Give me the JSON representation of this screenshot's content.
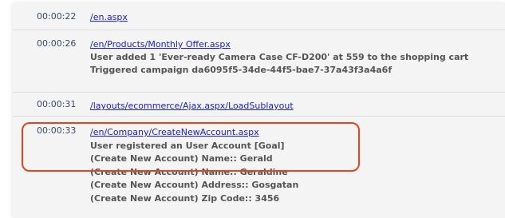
{
  "entries": [
    {
      "time": "00:00:22",
      "url": "/en.aspx",
      "details": []
    },
    {
      "time": "00:00:26",
      "url": "/en/Products/Monthly Offer.aspx",
      "details": [
        "User added 1 'Ever-ready Camera Case CF-D200' at 559 to the shopping cart",
        "Triggered campaign da6095f5-34de-44f5-bae7-37a43f3a4a6f"
      ]
    },
    {
      "time": "00:00:31",
      "url": "/layouts/ecommerce/Ajax.aspx/LoadSublayout",
      "details": []
    },
    {
      "time": "00:00:33",
      "url": "/en/Company/CreateNewAccount.aspx",
      "details": [
        "User registered an User Account [Goal]",
        "(Create New Account) Name:: Gerald",
        "(Create New Account) Name:: Geraldine",
        "(Create New Account) Address:: Gosgatan",
        "(Create New Account) Zip Code:: 3456"
      ]
    }
  ],
  "highlight_color": "#e8431e"
}
